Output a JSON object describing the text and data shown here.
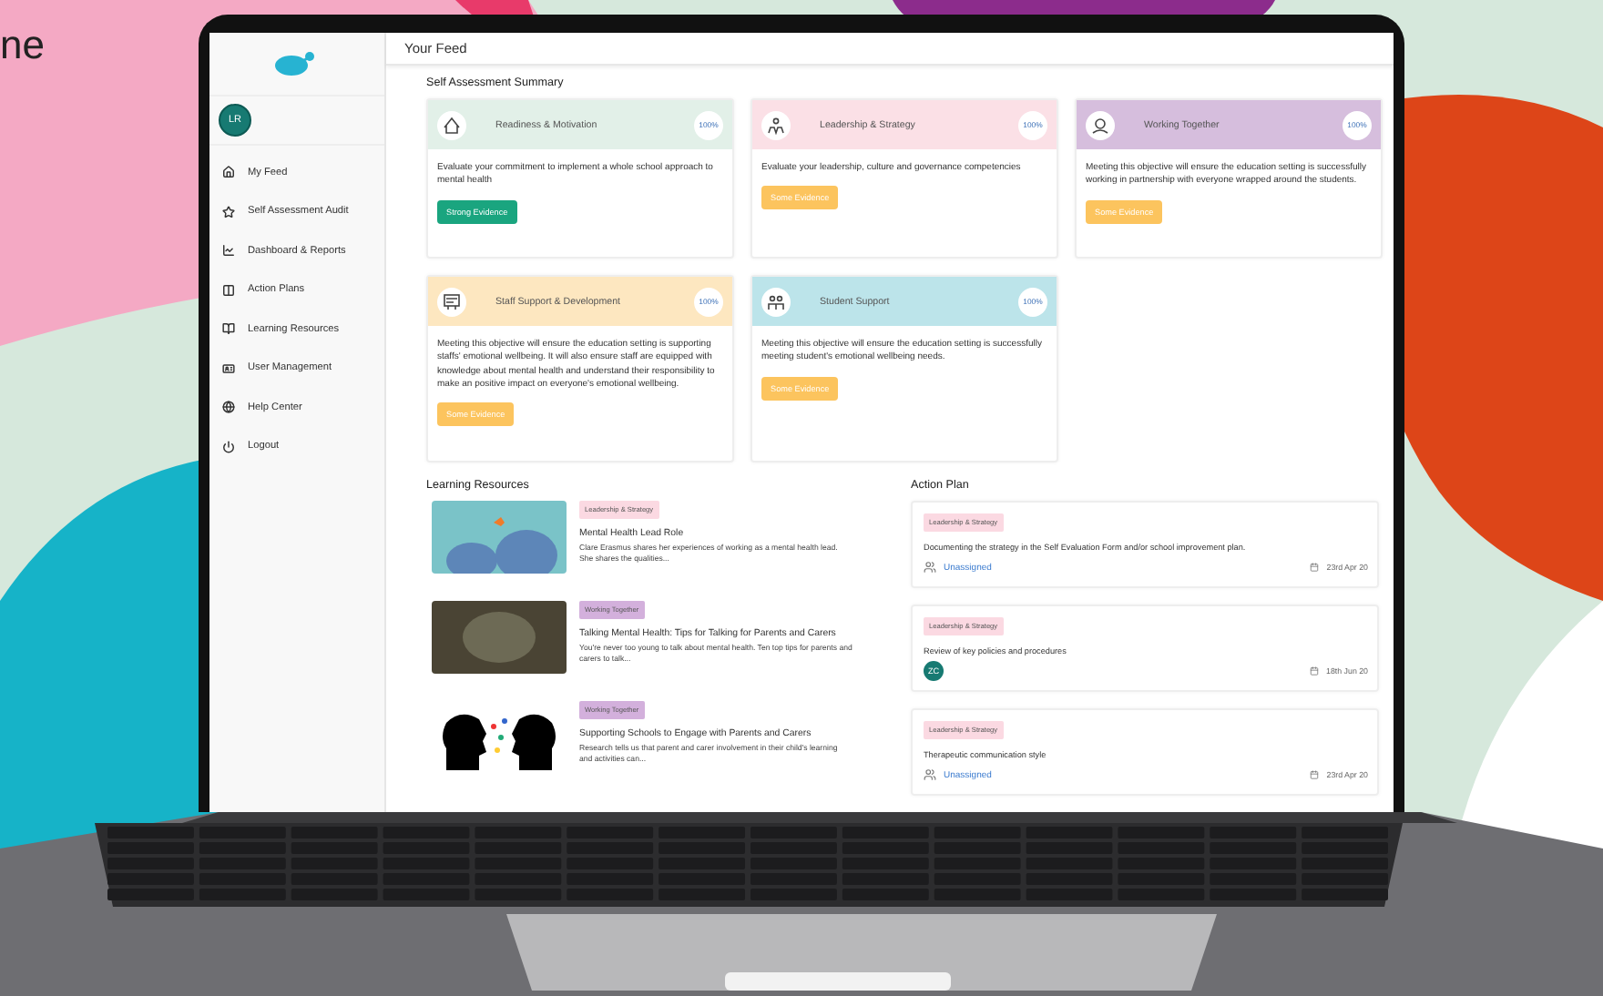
{
  "headline_fragment": "ne",
  "sidebar": {
    "avatar": "LR",
    "items": [
      {
        "label": "My Feed"
      },
      {
        "label": "Self Assessment Audit"
      },
      {
        "label": "Dashboard & Reports"
      },
      {
        "label": "Action Plans"
      },
      {
        "label": "Learning Resources"
      },
      {
        "label": "User Management"
      },
      {
        "label": "Help Center"
      },
      {
        "label": "Logout"
      }
    ]
  },
  "header": {
    "title": "Your Feed"
  },
  "summary": {
    "title": "Self Assessment Summary",
    "cards": [
      {
        "title": "Readiness & Motivation",
        "score": "100%",
        "color": "#e2f0e8",
        "description": "Evaluate your commitment to implement a whole school approach to mental health",
        "evidence": {
          "label": "Strong Evidence",
          "kind": "strong"
        }
      },
      {
        "title": "Leadership & Strategy",
        "score": "100%",
        "color": "#fbe0e6",
        "description": "Evaluate your leadership, culture and governance competencies",
        "evidence": {
          "label": "Some Evidence",
          "kind": "some"
        }
      },
      {
        "title": "Working Together",
        "score": "100%",
        "color": "#d6bedd",
        "description": "Meeting this objective will ensure the education setting is successfully working in partnership with everyone wrapped around the students.",
        "evidence": {
          "label": "Some Evidence",
          "kind": "some"
        }
      },
      {
        "title": "Staff Support & Development",
        "score": "100%",
        "color": "#fde7c0",
        "description": "Meeting this objective will ensure the education setting is supporting staffs' emotional wellbeing. It will also ensure staff are equipped with knowledge about mental health and understand their responsibility to make an positive impact on everyone's emotional wellbeing.",
        "evidence": {
          "label": "Some Evidence",
          "kind": "some"
        }
      },
      {
        "title": "Student Support",
        "score": "100%",
        "color": "#bce4ea",
        "description": "Meeting this objective will ensure the education setting is successfully meeting student's emotional wellbeing needs.",
        "evidence": {
          "label": "Some Evidence",
          "kind": "some"
        }
      }
    ]
  },
  "learning_resources": {
    "title": "Learning Resources",
    "items": [
      {
        "tag": "Leadership & Strategy",
        "color": "#fbd9e2",
        "title": "Mental Health Lead Role",
        "description": "Clare Erasmus shares her experiences of working as a mental health lead. She shares the qualities...",
        "kind": "illustration"
      },
      {
        "tag": "Working Together",
        "color": "#d3b0dc",
        "title": "Talking Mental Health: Tips for Talking for Parents and Carers",
        "description": "You're never too young to talk about mental health. Ten top tips for parents and carers to talk...",
        "kind": "photo"
      },
      {
        "tag": "Working Together",
        "color": "#d3b0dc",
        "title": "Supporting Schools to Engage with Parents and Carers",
        "description": "Research tells us that parent and carer involvement in their child's learning and activities can...",
        "kind": "illustration"
      }
    ]
  },
  "action_plan": {
    "title": "Action Plan",
    "items": [
      {
        "tag": "Leadership & Strategy",
        "color": "#fbd9e2",
        "text": "Documenting the strategy in the Self Evaluation Form and/or school improvement plan.",
        "assignee": {
          "kind": "unassigned",
          "label": "Unassigned"
        },
        "date": "23rd Apr 20"
      },
      {
        "tag": "Leadership & Strategy",
        "color": "#fbd9e2",
        "text": "Review of key policies and procedures",
        "assignee": {
          "kind": "user",
          "label": "ZC"
        },
        "date": "18th Jun 20"
      },
      {
        "tag": "Leadership & Strategy",
        "color": "#fbd9e2",
        "text": "Therapeutic communication style",
        "assignee": {
          "kind": "unassigned",
          "label": "Unassigned"
        },
        "date": "23rd Apr 20"
      }
    ]
  }
}
